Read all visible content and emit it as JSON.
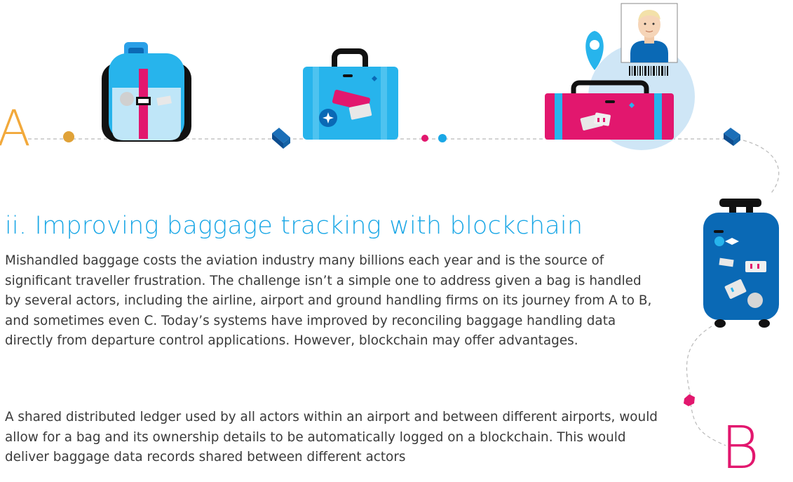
{
  "letters": {
    "start": "A",
    "end": "B"
  },
  "section": {
    "heading": "ii. Improving baggage tracking with blockchain",
    "paragraph_1": "Mishandled baggage costs the aviation industry many billions each year and is the source of significant traveller frustration. The challenge isn’t a simple one to address given a bag is handled by several actors, including the airline, airport and ground handling firms on its journey from A to B, and sometimes even C. Today’s systems have improved by reconciling baggage handling data directly from departure control applications. However, blockchain may offer advantages.",
    "paragraph_2": "A shared distributed ledger used by all actors within an airport and between different airports, would allow for a bag and its ownership details to be automatically logged on a blockchain. This would deliver baggage data records shared between different actors"
  },
  "colors": {
    "heading": "#1aa7e6",
    "light_blue": "#27b4ec",
    "dark_blue": "#0a69b5",
    "magenta": "#e2176e",
    "orange": "#f2a93b",
    "pale_blue": "#cfe6f6"
  },
  "icons": [
    "backpack-icon",
    "blue-suitcase-icon",
    "pink-suitcase-icon",
    "location-pin-icon",
    "passenger-photo-icon",
    "barcode-icon",
    "trolley-suitcase-icon"
  ]
}
